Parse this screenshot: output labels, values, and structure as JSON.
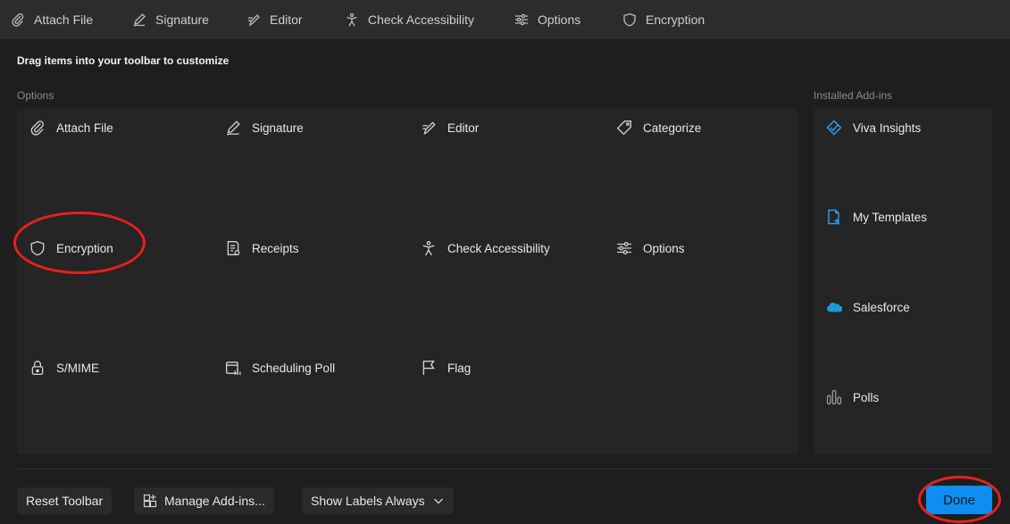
{
  "toolbar": {
    "items": [
      {
        "label": "Attach File",
        "icon": "paperclip-icon"
      },
      {
        "label": "Signature",
        "icon": "pen-icon"
      },
      {
        "label": "Editor",
        "icon": "editor-icon"
      },
      {
        "label": "Check Accessibility",
        "icon": "accessibility-icon"
      },
      {
        "label": "Options",
        "icon": "sliders-icon"
      },
      {
        "label": "Encryption",
        "icon": "shield-icon"
      }
    ]
  },
  "customize_hint": "Drag items into your toolbar to customize",
  "options": {
    "heading": "Options",
    "items": [
      {
        "label": "Attach File",
        "icon": "paperclip-icon"
      },
      {
        "label": "Signature",
        "icon": "pen-icon"
      },
      {
        "label": "Editor",
        "icon": "editor-icon"
      },
      {
        "label": "Categorize",
        "icon": "tag-icon"
      },
      {
        "label": "Encryption",
        "icon": "shield-icon"
      },
      {
        "label": "Receipts",
        "icon": "receipt-icon"
      },
      {
        "label": "Check Accessibility",
        "icon": "accessibility-icon"
      },
      {
        "label": "Options",
        "icon": "sliders-icon"
      },
      {
        "label": "S/MIME",
        "icon": "lock-icon"
      },
      {
        "label": "Scheduling Poll",
        "icon": "calendar-poll-icon"
      },
      {
        "label": "Flag",
        "icon": "flag-icon"
      }
    ]
  },
  "addins": {
    "heading": "Installed Add-ins",
    "items": [
      {
        "label": "Viva Insights",
        "icon": "viva-insights-icon"
      },
      {
        "label": "My Templates",
        "icon": "templates-icon"
      },
      {
        "label": "Salesforce",
        "icon": "salesforce-cloud-icon"
      },
      {
        "label": "Polls",
        "icon": "polls-icon"
      }
    ]
  },
  "footer": {
    "reset_label": "Reset Toolbar",
    "manage_label": "Manage Add-ins...",
    "show_labels": "Show Labels Always",
    "done_label": "Done"
  },
  "colors": {
    "accent": "#0f8df0",
    "highlight": "#e8201c",
    "addin_icon": "#2f9bf0"
  }
}
